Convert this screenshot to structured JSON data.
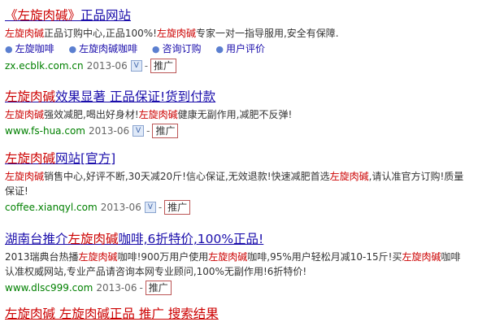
{
  "results": [
    {
      "title_parts": [
        "《左旋肉碱》",
        "正品网站"
      ],
      "desc_parts": [
        "左旋肉碱",
        "正品订购中心,正品100%!",
        "左旋肉碱",
        "专家一对一指导服用,安全有保障."
      ],
      "links": [
        "左旋咖啡",
        "左旋肉碱咖啡",
        "咨询订购",
        "用户评价"
      ],
      "url": "zx.ecblk.com.cn",
      "date": "2013-06",
      "verify_badge": "V",
      "promo": "推广"
    },
    {
      "title_parts": [
        "左旋肉碱",
        "效果显著 正品保证!货到付款"
      ],
      "desc_parts": [
        "左旋肉碱",
        "强效减肥,喝出好身材!",
        "左旋肉碱",
        "健康无副作用,减肥不反弹!"
      ],
      "url": "www.fs-hua.com",
      "date": "2013-06",
      "verify_badge": "V",
      "promo": "推广"
    },
    {
      "title_parts": [
        "左旋肉碱",
        "网站[官方]"
      ],
      "desc_parts": [
        "左旋肉碱",
        "销售中心,好评不断,30天减20斤!信心保证,无效退款!快速减肥首选",
        "左旋肉碱",
        ",请认准官方订购!质量保证!"
      ],
      "url": "coffee.xianqyl.com",
      "date": "2013-06",
      "verify_badge": "V",
      "promo": "推广"
    },
    {
      "title_parts": [
        "湖南台推介",
        "左旋肉碱",
        "咖啡,6折特价,100%正品!"
      ],
      "desc_parts": [
        "2013瑞典台热播",
        "左旋肉碱",
        "咖啡!900万用户使用",
        "左旋肉碱",
        "咖啡,95%用户轻松月减10-15斤!买",
        "左旋肉碱",
        "咖啡认准权威网站,专业产品请咨询本网专业顾问,100%无副作用!6折特价!"
      ],
      "url": "www.dlsc999.com",
      "date": "2013-06",
      "promo": "推广"
    }
  ],
  "cutoff_text": "左旋肉碱 左旋肉碱正品 推广 搜索结果"
}
